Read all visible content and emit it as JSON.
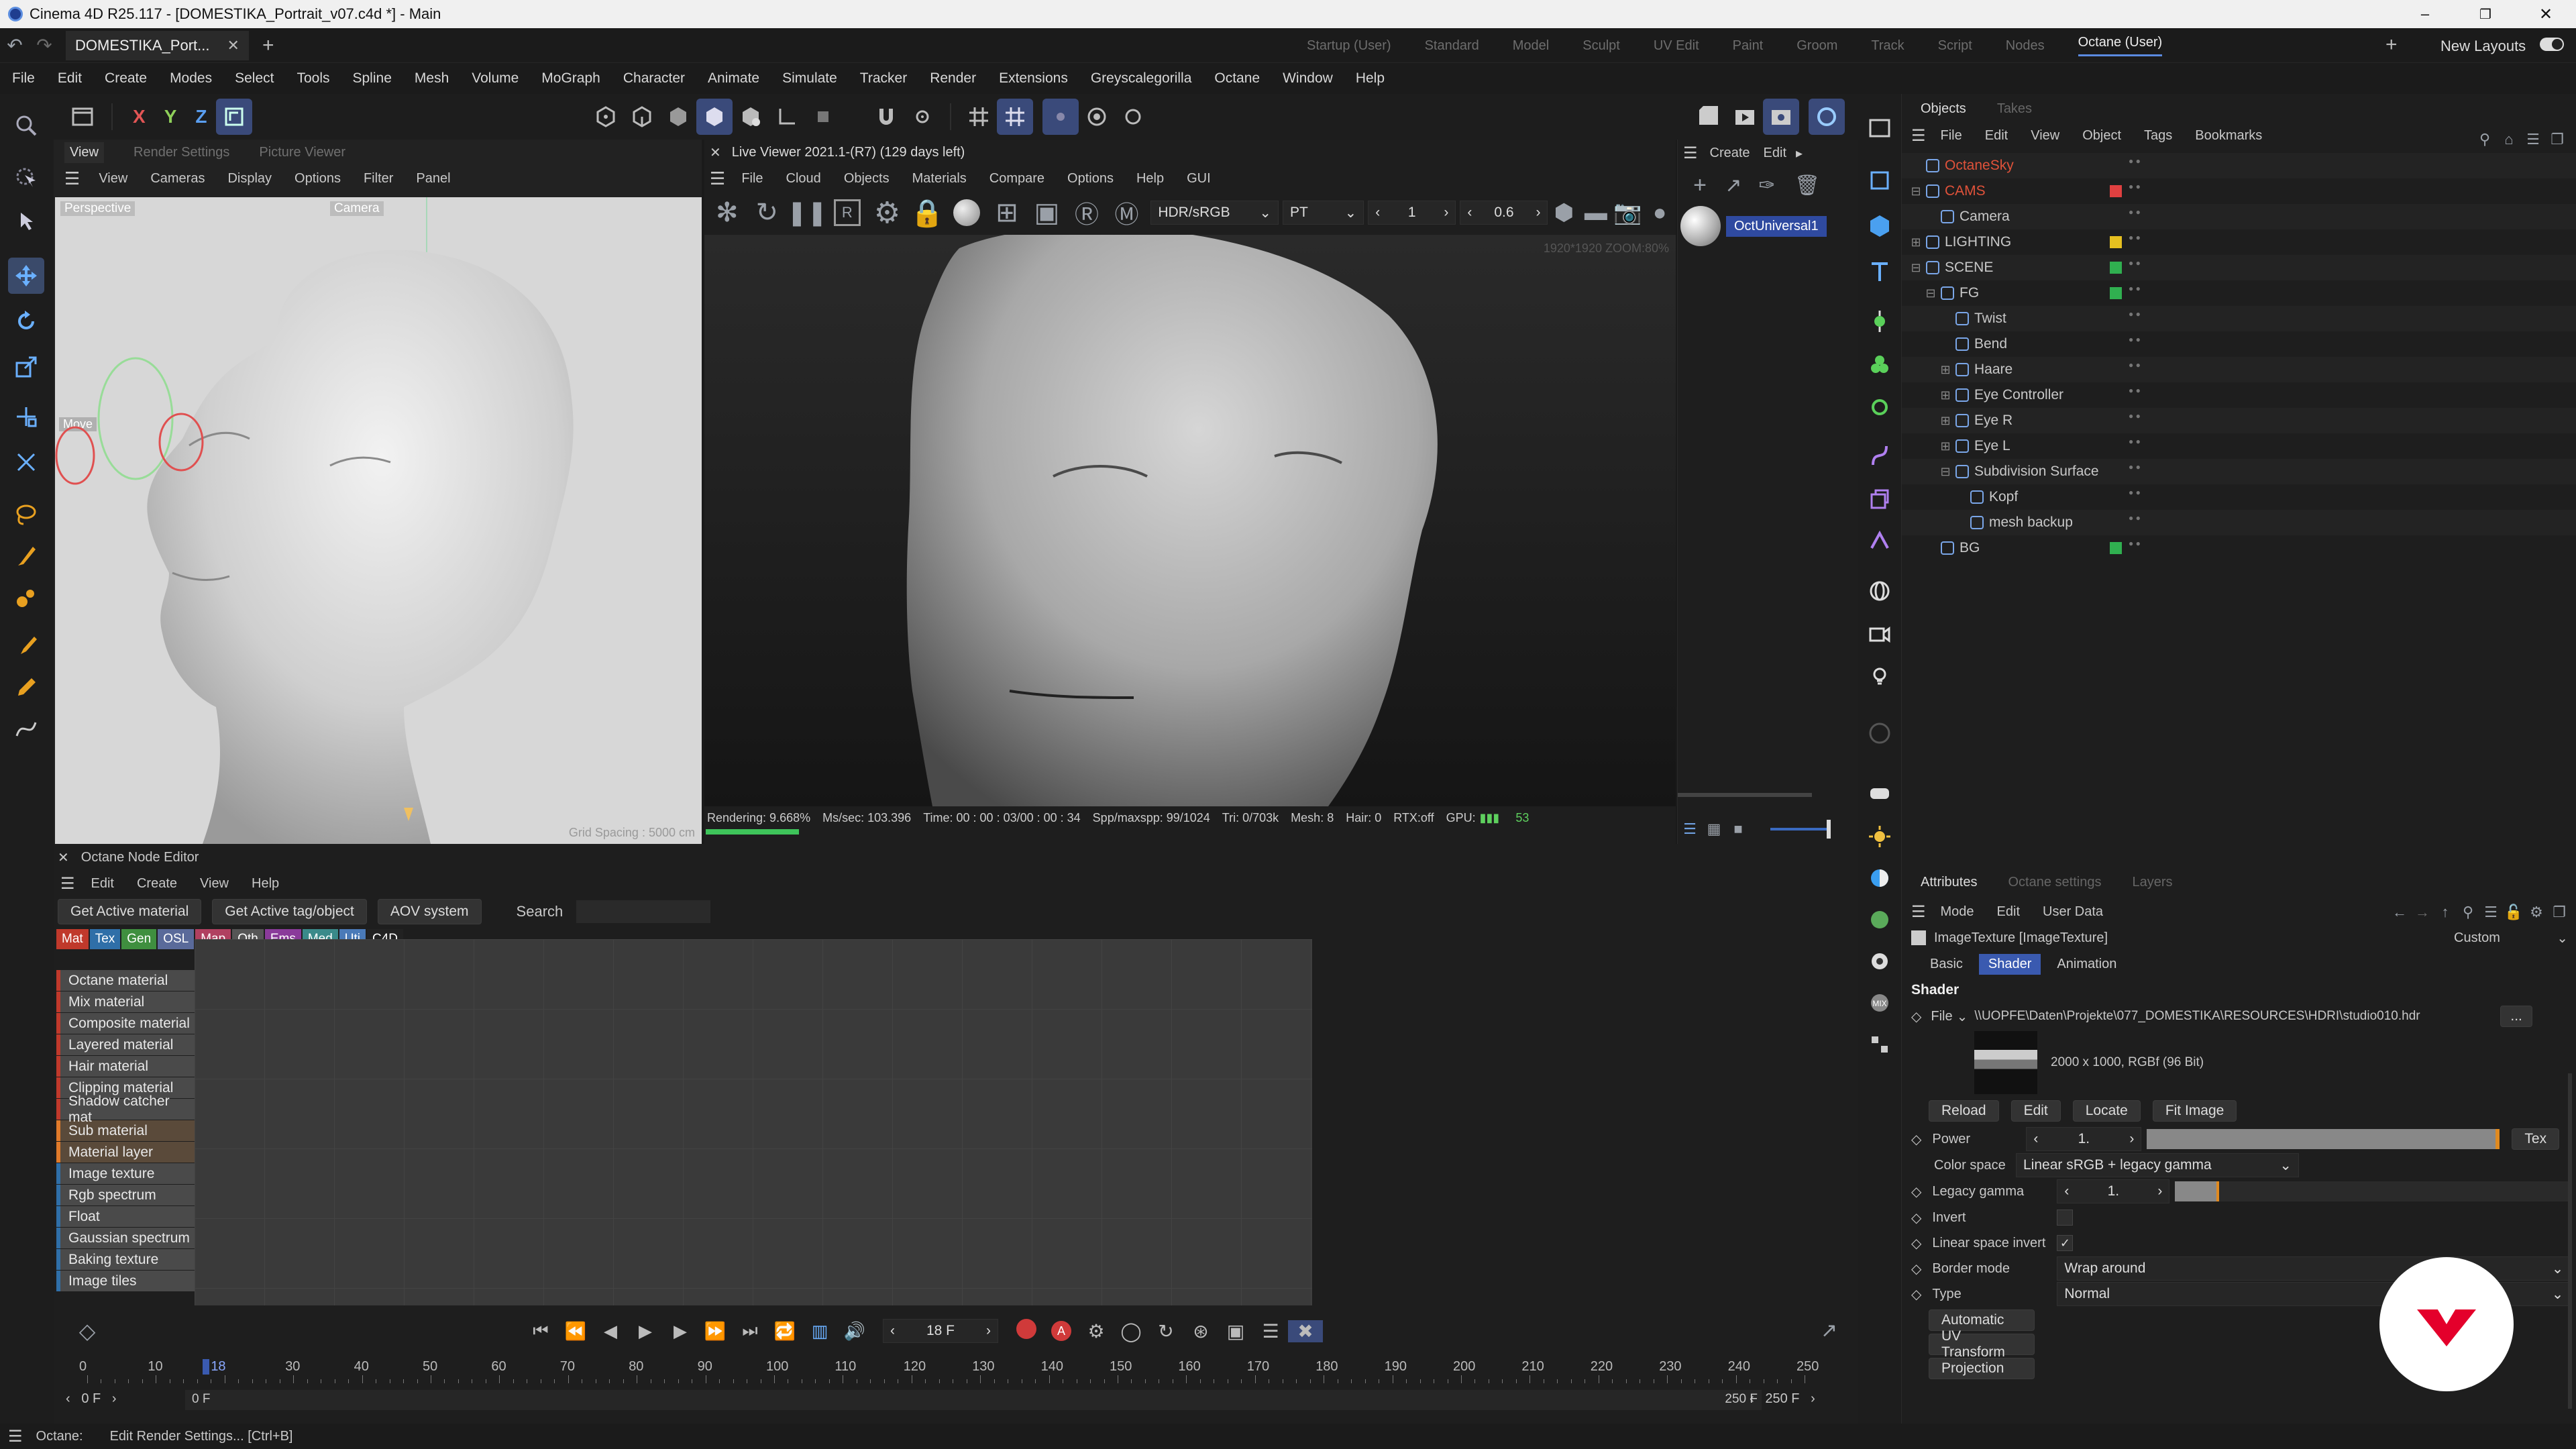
{
  "window": {
    "title": "Cinema 4D R25.117 - [DOMESTIKA_Portrait_v07.c4d *] - Main"
  },
  "doc_tab": {
    "label": "DOMESTIKA_Port..."
  },
  "layout_tabs": [
    "Startup (User)",
    "Standard",
    "Model",
    "Sculpt",
    "UV Edit",
    "Paint",
    "Groom",
    "Track",
    "Script",
    "Nodes",
    "Octane (User)"
  ],
  "new_layouts": "New Layouts",
  "main_menu": [
    "File",
    "Edit",
    "Create",
    "Modes",
    "Select",
    "Tools",
    "Spline",
    "Mesh",
    "Volume",
    "MoGraph",
    "Character",
    "Animate",
    "Simulate",
    "Tracker",
    "Render",
    "Extensions",
    "Greyscalegorilla",
    "Octane",
    "Window",
    "Help"
  ],
  "axes": {
    "x": "X",
    "y": "Y",
    "z": "Z"
  },
  "viewport": {
    "tabs": [
      "View",
      "Render Settings",
      "Picture Viewer"
    ],
    "menu": [
      "View",
      "Cameras",
      "Display",
      "Options",
      "Filter",
      "Panel"
    ],
    "label_perspective": "Perspective",
    "label_camera": "Camera",
    "label_move": "Move",
    "grid_spacing": "Grid Spacing : 5000 cm"
  },
  "live_viewer": {
    "title": "Live Viewer 2021.1-(R7) (129 days left)",
    "menu": [
      "File",
      "Cloud",
      "Objects",
      "Materials",
      "Compare",
      "Options",
      "Help",
      "GUI"
    ],
    "color_mode": "HDR/sRGB",
    "kernel": "PT",
    "value_1": "1",
    "value_2": "0.6",
    "overlay": "1920*1920 ZOOM:80%",
    "status": {
      "rendering": "Rendering: 9.668%",
      "ms_sec": "Ms/sec: 103.396",
      "time": "Time: 00 : 00 : 03/00 : 00 : 34",
      "spp": "Spp/maxspp: 99/1024",
      "tri": "Tri: 0/703k",
      "mesh": "Mesh: 8",
      "hair": "Hair: 0",
      "rtx": "RTX:off",
      "gpu": "GPU:",
      "gpu_val": "53"
    },
    "progress": 0.09668
  },
  "material_preview": {
    "create": "Create",
    "edit": "Edit",
    "name": "OctUniversal1"
  },
  "node_editor": {
    "title": "Octane Node Editor",
    "menu": [
      "Edit",
      "Create",
      "View",
      "Help"
    ],
    "buttons": [
      "Get Active material",
      "Get Active tag/object",
      "AOV system"
    ],
    "search_label": "Search",
    "categories": [
      {
        "label": "Mat",
        "color": "#c0392b"
      },
      {
        "label": "Tex",
        "color": "#2f6fa8"
      },
      {
        "label": "Gen",
        "color": "#3f8f3f"
      },
      {
        "label": "OSL",
        "color": "#5a6a9a"
      },
      {
        "label": "Map",
        "color": "#b04060"
      },
      {
        "label": "Oth",
        "color": "#555555"
      },
      {
        "label": "Ems",
        "color": "#8a3a9a"
      },
      {
        "label": "Med",
        "color": "#3a8a8a"
      },
      {
        "label": "Uti",
        "color": "#4a7ab8"
      },
      {
        "label": "C4D",
        "color": "#222222"
      }
    ],
    "library": [
      {
        "label": "Octane material",
        "color": "#c0392b"
      },
      {
        "label": "Mix material",
        "color": "#c0392b"
      },
      {
        "label": "Composite material",
        "color": "#c0392b"
      },
      {
        "label": "Layered material",
        "color": "#c0392b"
      },
      {
        "label": "Hair material",
        "color": "#c0392b"
      },
      {
        "label": "Clipping material",
        "color": "#c0392b"
      },
      {
        "label": "Shadow catcher mat",
        "color": "#c0392b"
      },
      {
        "label": "Sub material",
        "color": "#e07a2a"
      },
      {
        "label": "Material layer",
        "color": "#e07a2a"
      },
      {
        "label": "Image texture",
        "color": "#2f6fa8"
      },
      {
        "label": "Rgb spectrum",
        "color": "#2f6fa8"
      },
      {
        "label": "Float",
        "color": "#2f6fa8"
      },
      {
        "label": "Gaussian spectrum",
        "color": "#2f6fa8"
      },
      {
        "label": "Baking texture",
        "color": "#2f6fa8"
      },
      {
        "label": "Image tiles",
        "color": "#2f6fa8"
      }
    ]
  },
  "timeline": {
    "current_frame": "18 F",
    "ticks": [
      "0",
      "10",
      "18",
      "30",
      "40",
      "50",
      "60",
      "70",
      "80",
      "90",
      "100",
      "110",
      "120",
      "130",
      "140",
      "150",
      "160",
      "170",
      "180",
      "190",
      "200",
      "210",
      "220",
      "230",
      "240",
      "250"
    ],
    "start": "0 F",
    "start2": "0 F",
    "end": "250 F",
    "end2": "250 F"
  },
  "objects_panel": {
    "tabs": [
      "Objects",
      "Takes"
    ],
    "menu": [
      "File",
      "Edit",
      "View",
      "Object",
      "Tags",
      "Bookmarks"
    ],
    "tree": [
      {
        "label": "OctaneSky",
        "level": 0,
        "color": "#e0523a",
        "dot": "",
        "expand": ""
      },
      {
        "label": "CAMS",
        "level": 0,
        "color": "#e0523a",
        "dot": "#e04040",
        "expand": "-"
      },
      {
        "label": "Camera",
        "level": 1,
        "color": "#c8c8c8",
        "dot": "",
        "expand": ""
      },
      {
        "label": "LIGHTING",
        "level": 0,
        "color": "#c8c8c8",
        "dot": "#e6c020",
        "expand": "+"
      },
      {
        "label": "SCENE",
        "level": 0,
        "color": "#c8c8c8",
        "dot": "#30b050",
        "expand": "-"
      },
      {
        "label": "FG",
        "level": 1,
        "color": "#c8c8c8",
        "dot": "#30b050",
        "expand": "-"
      },
      {
        "label": "Twist",
        "level": 2,
        "color": "#c8c8c8",
        "dot": "",
        "expand": ""
      },
      {
        "label": "Bend",
        "level": 2,
        "color": "#c8c8c8",
        "dot": "",
        "expand": ""
      },
      {
        "label": "Haare",
        "level": 2,
        "color": "#c8c8c8",
        "dot": "",
        "expand": "+"
      },
      {
        "label": "Eye Controller",
        "level": 2,
        "color": "#c8c8c8",
        "dot": "",
        "expand": "+"
      },
      {
        "label": "Eye R",
        "level": 2,
        "color": "#c8c8c8",
        "dot": "",
        "expand": "+"
      },
      {
        "label": "Eye L",
        "level": 2,
        "color": "#c8c8c8",
        "dot": "",
        "expand": "+"
      },
      {
        "label": "Subdivision Surface",
        "level": 2,
        "color": "#c8c8c8",
        "dot": "",
        "expand": "-"
      },
      {
        "label": "Kopf",
        "level": 3,
        "color": "#c8c8c8",
        "dot": "",
        "expand": ""
      },
      {
        "label": "mesh backup",
        "level": 3,
        "color": "#c8c8c8",
        "dot": "",
        "expand": ""
      },
      {
        "label": "BG",
        "level": 1,
        "color": "#c8c8c8",
        "dot": "#30b050",
        "expand": ""
      }
    ]
  },
  "attributes": {
    "tabs": [
      "Attributes",
      "Octane settings",
      "Layers"
    ],
    "menu": [
      "Mode",
      "Edit",
      "User Data"
    ],
    "object_title": "ImageTexture [ImageTexture]",
    "preset": "Custom",
    "sub_tabs": [
      "Basic",
      "Shader",
      "Animation"
    ],
    "section": "Shader",
    "file_label": "File",
    "file_path": "\\\\UOPFE\\Daten\\Projekte\\077_DOMESTIKA\\RESOURCES\\HDRI\\studio010.hdr",
    "file_browse": "...",
    "image_info": "2000 x 1000, RGBf (96 Bit)",
    "image_buttons": [
      "Reload",
      "Edit",
      "Locate",
      "Fit Image"
    ],
    "power_label": "Power",
    "power_value": "1.",
    "power_tex": "Tex",
    "color_space_label": "Color space",
    "color_space_value": "Linear sRGB + legacy gamma",
    "legacy_gamma_label": "Legacy gamma",
    "legacy_gamma_value": "1.",
    "invert_label": "Invert",
    "invert_checked": false,
    "linear_invert_label": "Linear space invert",
    "linear_invert_checked": true,
    "border_mode_label": "Border mode",
    "border_mode_value": "Wrap around",
    "type_label": "Type",
    "type_value": "Normal",
    "bottom_buttons": [
      "Automatic",
      "UV Transform",
      "Projection"
    ]
  },
  "statusbar": {
    "left": "Octane:",
    "text": "Edit Render Settings... [Ctrl+B]"
  }
}
